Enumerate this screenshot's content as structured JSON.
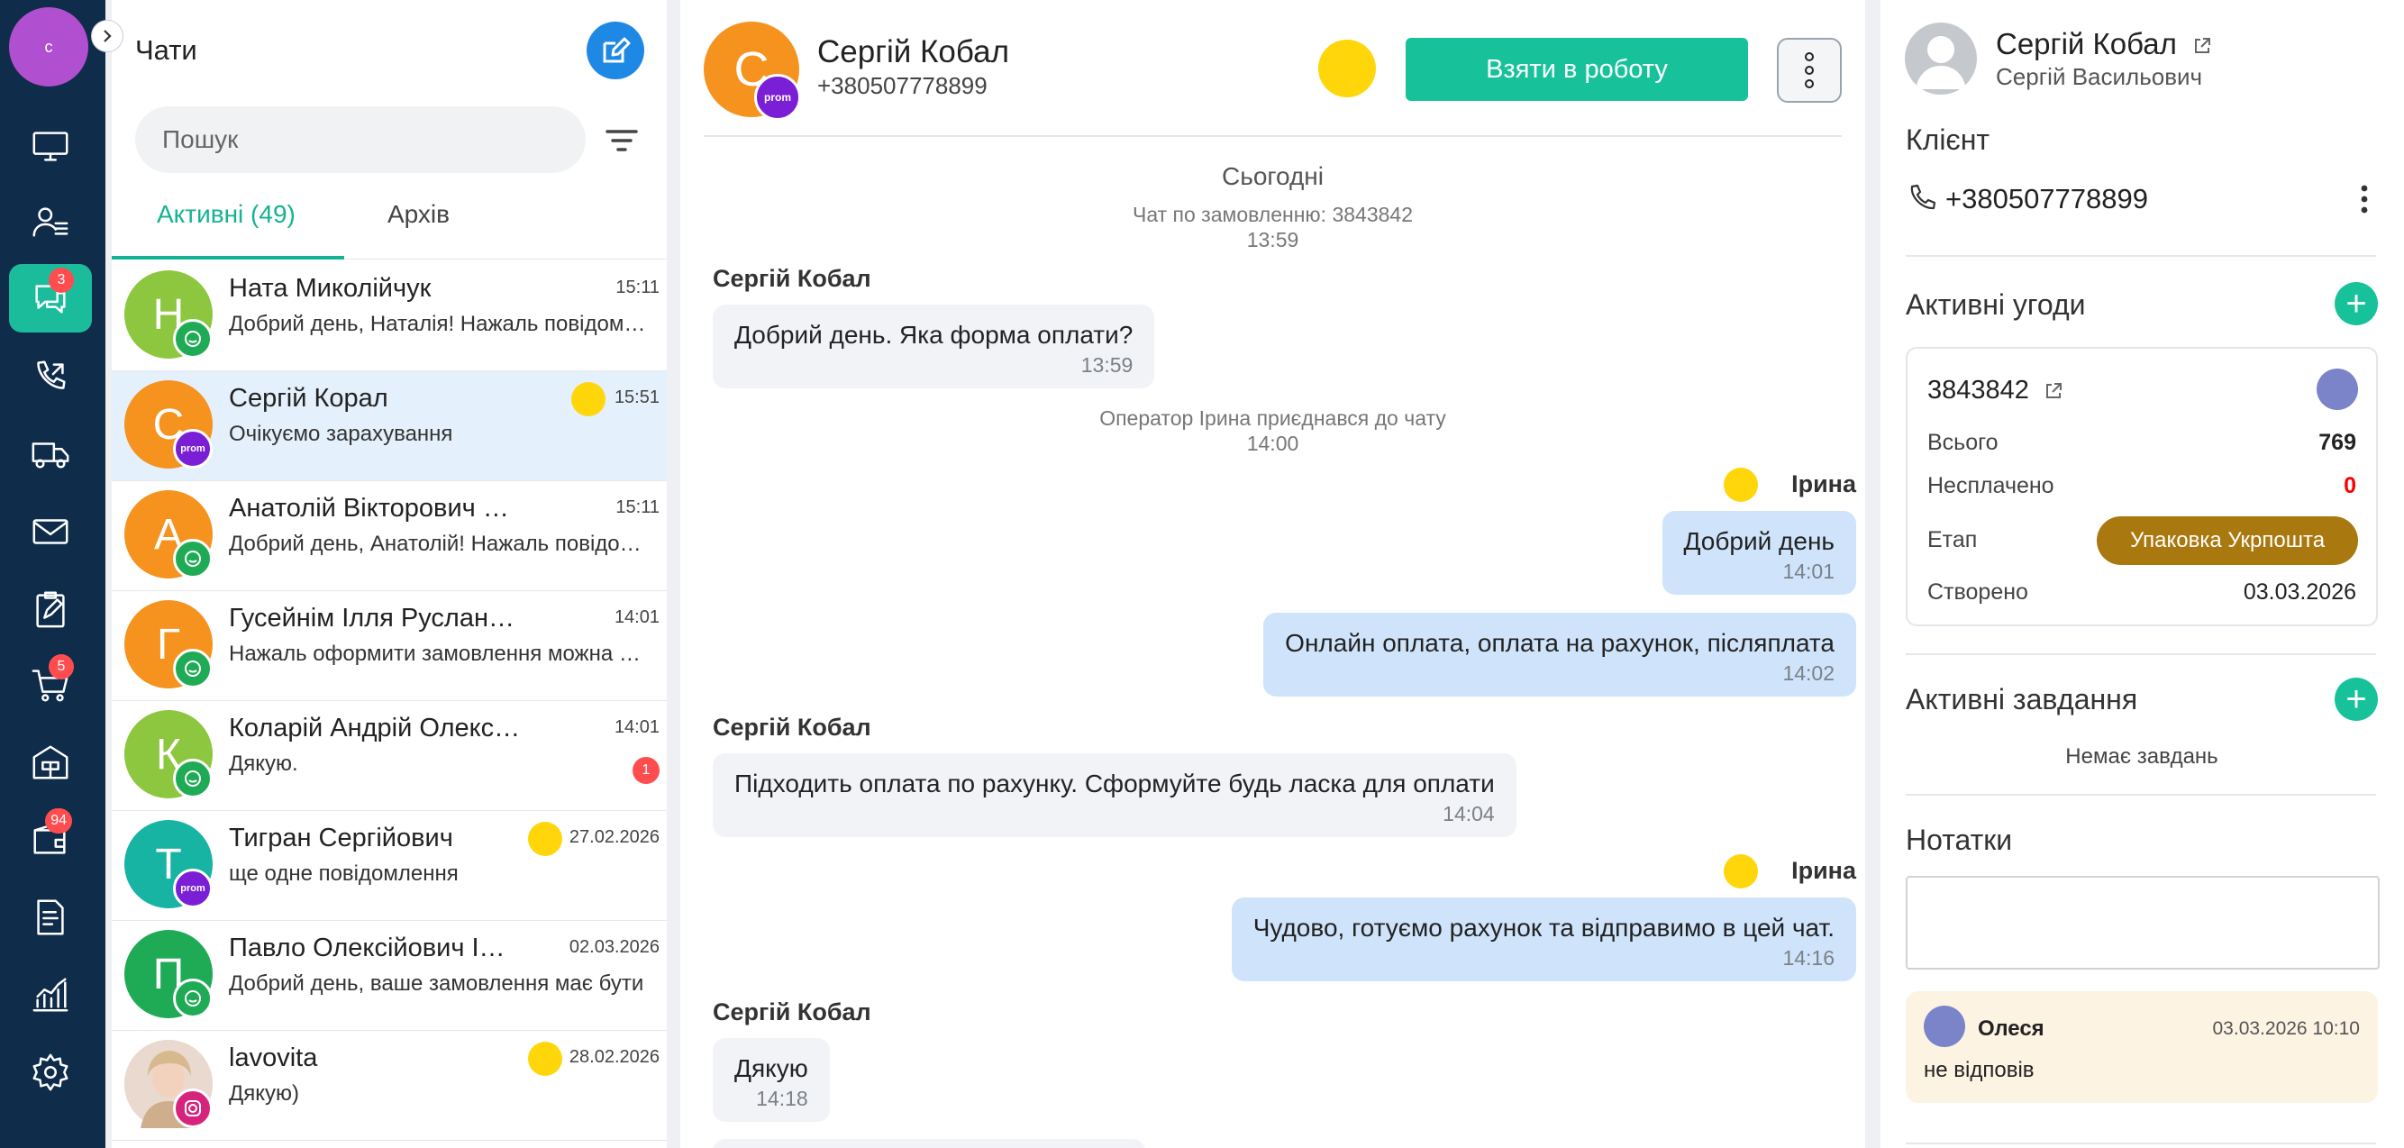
{
  "rail": {
    "avatar_initial": "с",
    "items": [
      {
        "icon": "monitor-icon"
      },
      {
        "icon": "user-list-icon"
      },
      {
        "icon": "chat-icon",
        "badge": "3",
        "active": true
      },
      {
        "icon": "phone-icon"
      },
      {
        "icon": "truck-icon"
      },
      {
        "icon": "mail-icon"
      },
      {
        "icon": "clipboard-icon"
      },
      {
        "icon": "cart-icon",
        "badge": "5"
      },
      {
        "icon": "warehouse-icon"
      },
      {
        "icon": "wallet-icon",
        "badge": "94"
      },
      {
        "icon": "document-icon"
      },
      {
        "icon": "analytics-icon"
      },
      {
        "icon": "settings-icon"
      }
    ]
  },
  "chat_list": {
    "title": "Чати",
    "search_placeholder": "Пошук",
    "tabs": [
      {
        "label": "Активні (49)"
      },
      {
        "label": "Архів"
      }
    ],
    "items": [
      {
        "initial": "Н",
        "color": "#8dc63f",
        "name": "Ната Миколійчук",
        "time": "15:11",
        "preview": "Добрий день, Наталія! Нажаль повідомляємо",
        "source": "viber"
      },
      {
        "initial": "С",
        "color": "#f6921e",
        "name": "Сергій Корал",
        "time": "15:51",
        "preview": "Очікуємо зарахування",
        "source": "prom",
        "source_label": "prom",
        "operator": true,
        "selected": true
      },
      {
        "initial": "А",
        "color": "#f6921e",
        "name": "Анатолій Вікторович Анатолій",
        "time": "15:11",
        "preview": "Добрий день, Анатолій! Нажаль повідомляємо",
        "source": "viber"
      },
      {
        "initial": "Г",
        "color": "#f6921e",
        "name": "Гусейнім Ілля Русланович",
        "time": "14:01",
        "preview": "Нажаль оформити замовлення можна лише",
        "source": "viber"
      },
      {
        "initial": "К",
        "color": "#8dc63f",
        "name": "Коларій Андрій Олександрович",
        "time": "14:01",
        "preview": "Дякую.",
        "source": "viber",
        "unread": "1"
      },
      {
        "initial": "Т",
        "color": "#17b3a3",
        "name": "Тигран Сергійович",
        "time": "27.02.2026",
        "preview": "ще одне повідомлення",
        "source": "prom",
        "source_label": "prom",
        "operator": true
      },
      {
        "initial": "П",
        "color": "#1faa55",
        "name": "Павло Олексійович Іванов",
        "time": "02.03.2026",
        "preview": "Добрий день, ваше замовлення має бути",
        "source": "viber"
      },
      {
        "initial": "",
        "color": "#d9c2b4",
        "name": "lavovita",
        "time": "28.02.2026",
        "preview": "Дякую)",
        "source": "instagram",
        "operator": true
      }
    ]
  },
  "conversation": {
    "avatar_initial": "С",
    "avatar_badge": "prom",
    "name": "Сергій Кобал",
    "phone": "+380507778899",
    "take_button": "Взяти в роботу",
    "day": "Сьогодні",
    "system": [
      {
        "text": "Чат по замовленню: 3843842",
        "time": "13:59"
      },
      {
        "text": "Оператор Ірина приєднався до чату",
        "time": "14:00"
      }
    ],
    "messages": [
      {
        "sender": "Сергій Кобал",
        "text": "Добрий день. Яка форма оплати?",
        "time": "13:59"
      },
      {
        "sender": "Ірина",
        "text": "Добрий день",
        "time": "14:01"
      },
      {
        "text": "Онлайн оплата, оплата на рахунок, післяплата",
        "time": "14:02"
      },
      {
        "sender": "Сергій Кобал",
        "text": "Підходить оплата по рахунку. Сформуйте будь ласка для оплати",
        "time": "14:04"
      },
      {
        "sender": "Ірина",
        "text": "Чудово, готуємо рахунок та відправимо в цей чат.",
        "time": "14:16"
      },
      {
        "sender": "Сергій Кобал",
        "text": "Дякую",
        "time": "14:18"
      }
    ]
  },
  "info": {
    "name": "Сергій Кобал",
    "full_name": "Сергій Васильович",
    "client_heading": "Клієнт",
    "phone": "+380507778899",
    "deals_heading": "Активні угоди",
    "deal": {
      "number": "3843842",
      "total_label": "Всього",
      "total": "769",
      "unpaid_label": "Несплачено",
      "unpaid": "0",
      "stage_label": "Етап",
      "stage": "Упаковка Укрпошта",
      "created_label": "Створено",
      "created": "03.03.2026"
    },
    "tasks_heading": "Активні завдання",
    "tasks_empty": "Немає завдань",
    "notes_heading": "Нотатки",
    "note": {
      "author": "Олеся",
      "date": "03.03.2026 10:10",
      "text": "не відповів"
    }
  },
  "colors": {
    "accent": "#17c29b",
    "rail": "#0f2c4a",
    "stage": "#a9780e",
    "unpaid": "#ff0000"
  }
}
